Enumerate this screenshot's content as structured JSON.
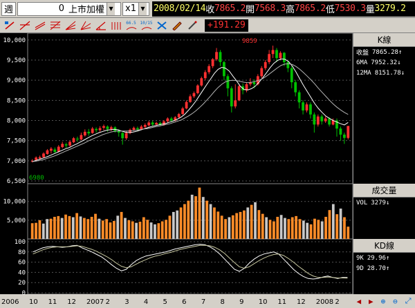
{
  "quote_bar": {
    "period": "週",
    "stock_code": "0",
    "stock_name": "上市加權",
    "multiplier": "x1",
    "date": "2008/02/14",
    "close_label": "收",
    "close": "7865.2",
    "open_label": "開",
    "open": "7568.3",
    "high_label": "高",
    "high": "7865.2",
    "low_label": "低",
    "low": "7530.3",
    "volume_label": "量",
    "volume": "3279.2"
  },
  "toolbar": {
    "change": "+191.29",
    "tool_icons": [
      "cursor-draw-icon",
      "trendline-icon",
      "parallel-line-icon",
      "fibonacci-icon",
      "fan-icon",
      "speed-line-icon",
      "angle-icon",
      "cycle-icon",
      "ma-66-icon",
      "ma-10-15-icon",
      "delete-icon",
      "pencil-icon",
      "hand-icon"
    ],
    "ma_short": "66.5",
    "ma_pair": "10/15"
  },
  "kline_panel": {
    "title": "K線",
    "rows": [
      {
        "label": "收盤",
        "value": "7865.28",
        "arrow": "↑"
      },
      {
        "label": "6MA",
        "value": "7952.32",
        "arrow": "↓"
      },
      {
        "label": "12MA",
        "value": "8151.78",
        "arrow": "↓"
      }
    ],
    "low_mark": "6980",
    "high_mark": "9859",
    "colors": {
      "ma6": "#ffffff",
      "ma12": "#c8c8c8",
      "up": "#ff3030",
      "down": "#00c000"
    }
  },
  "volume_panel": {
    "title": "成交量",
    "rows": [
      {
        "label": "VOL",
        "value": "3279",
        "arrow": "↓"
      }
    ]
  },
  "kd_panel": {
    "title": "KD線",
    "rows": [
      {
        "label": "9K",
        "value": "29.96",
        "arrow": "↑"
      },
      {
        "label": "9D",
        "value": "28.70",
        "arrow": "↑"
      }
    ]
  },
  "nav_icons": [
    "scroll-left-icon",
    "scroll-right-icon",
    "zoom-in-icon",
    "zoom-out-icon",
    "restore-icon"
  ],
  "chart_data": [
    {
      "type": "candlestick",
      "title": "K線",
      "yticks": [
        "10,000",
        "9,500",
        "9,000",
        "8,500",
        "8,000",
        "7,500",
        "7,000",
        "6,500"
      ],
      "ylim": [
        6500,
        10100
      ],
      "xticks": [
        "2006",
        "10",
        "11",
        "12",
        "2007",
        "2",
        "3",
        "4",
        "5",
        "6",
        "7",
        "8",
        "9",
        "10",
        "11",
        "12",
        "2008",
        "2"
      ],
      "candles": [
        [
          6980,
          7000,
          6960,
          7040
        ],
        [
          7020,
          7080,
          7000,
          7110
        ],
        [
          7060,
          7090,
          7030,
          7130
        ],
        [
          7090,
          7180,
          7070,
          7210
        ],
        [
          7170,
          7260,
          7150,
          7290
        ],
        [
          7250,
          7300,
          7180,
          7340
        ],
        [
          7280,
          7220,
          7180,
          7330
        ],
        [
          7230,
          7350,
          7210,
          7390
        ],
        [
          7340,
          7420,
          7310,
          7470
        ],
        [
          7410,
          7380,
          7320,
          7450
        ],
        [
          7380,
          7470,
          7350,
          7500
        ],
        [
          7460,
          7560,
          7440,
          7590
        ],
        [
          7550,
          7530,
          7470,
          7600
        ],
        [
          7530,
          7640,
          7510,
          7700
        ],
        [
          7630,
          7720,
          7600,
          7780
        ],
        [
          7720,
          7680,
          7620,
          7790
        ],
        [
          7690,
          7800,
          7670,
          7840
        ],
        [
          7790,
          7760,
          7700,
          7830
        ],
        [
          7760,
          7810,
          7720,
          7860
        ],
        [
          7820,
          7860,
          7760,
          7900
        ],
        [
          7850,
          7790,
          7720,
          7880
        ],
        [
          7790,
          7830,
          7740,
          7870
        ],
        [
          7830,
          7740,
          7700,
          7860
        ],
        [
          7740,
          7700,
          7600,
          7780
        ],
        [
          7690,
          7560,
          7400,
          7720
        ],
        [
          7560,
          7690,
          7520,
          7740
        ],
        [
          7690,
          7770,
          7660,
          7800
        ],
        [
          7770,
          7820,
          7740,
          7850
        ],
        [
          7810,
          7780,
          7730,
          7850
        ],
        [
          7780,
          7850,
          7760,
          7890
        ],
        [
          7840,
          7890,
          7800,
          7930
        ],
        [
          7880,
          7950,
          7850,
          7990
        ],
        [
          7950,
          7900,
          7860,
          7990
        ],
        [
          7900,
          7940,
          7880,
          7970
        ],
        [
          7940,
          7890,
          7860,
          7970
        ],
        [
          7890,
          7980,
          7870,
          8010
        ],
        [
          7980,
          8050,
          7950,
          8080
        ],
        [
          8050,
          8000,
          7960,
          8090
        ],
        [
          8000,
          8080,
          7980,
          8110
        ],
        [
          8080,
          8160,
          8050,
          8190
        ],
        [
          8160,
          8300,
          8140,
          8340
        ],
        [
          8300,
          8460,
          8280,
          8500
        ],
        [
          8460,
          8600,
          8440,
          8650
        ],
        [
          8600,
          8680,
          8560,
          8720
        ],
        [
          8680,
          8870,
          8650,
          8900
        ],
        [
          8870,
          9050,
          8840,
          9090
        ],
        [
          9050,
          9200,
          9000,
          9250
        ],
        [
          9200,
          9350,
          9150,
          9400
        ],
        [
          9350,
          9520,
          9300,
          9550
        ],
        [
          9520,
          9700,
          9480,
          9800
        ],
        [
          9700,
          9450,
          9350,
          9750
        ],
        [
          9450,
          9100,
          9000,
          9480
        ],
        [
          9100,
          8800,
          8600,
          9150
        ],
        [
          8800,
          8350,
          8200,
          8850
        ],
        [
          8350,
          8500,
          8300,
          8900
        ],
        [
          8500,
          8850,
          8480,
          8900
        ],
        [
          8850,
          8750,
          8650,
          8920
        ],
        [
          8750,
          8900,
          8700,
          8950
        ],
        [
          8900,
          8950,
          8850,
          9050
        ],
        [
          8950,
          8900,
          8800,
          9020
        ],
        [
          8900,
          9100,
          8870,
          9150
        ],
        [
          9100,
          9300,
          9050,
          9350
        ],
        [
          9300,
          9450,
          9250,
          9500
        ],
        [
          9450,
          9650,
          9400,
          9750
        ],
        [
          9650,
          9750,
          9550,
          9859
        ],
        [
          9750,
          9550,
          9450,
          9800
        ],
        [
          9550,
          9680,
          9500,
          9720
        ],
        [
          9680,
          9450,
          9350,
          9700
        ],
        [
          9450,
          9300,
          9200,
          9480
        ],
        [
          9300,
          8950,
          8800,
          9350
        ],
        [
          8950,
          8700,
          8600,
          9000
        ],
        [
          8700,
          8450,
          8300,
          8750
        ],
        [
          8450,
          8250,
          8150,
          8500
        ],
        [
          8250,
          8400,
          8200,
          8450
        ],
        [
          8400,
          8150,
          8050,
          8450
        ],
        [
          8150,
          7900,
          7700,
          8200
        ],
        [
          7900,
          8100,
          7850,
          8150
        ],
        [
          8100,
          7980,
          7900,
          8150
        ],
        [
          7980,
          8050,
          7940,
          8100
        ],
        [
          8050,
          7900,
          7850,
          8080
        ],
        [
          7900,
          8000,
          7880,
          8050
        ],
        [
          8000,
          7800,
          7600,
          8050
        ],
        [
          7800,
          7650,
          7500,
          7850
        ],
        [
          7650,
          7568,
          7420,
          7700
        ],
        [
          7568,
          7865,
          7530,
          7865
        ]
      ],
      "ma6": [
        6980,
        7010,
        7040,
        7070,
        7100,
        7140,
        7180,
        7220,
        7260,
        7300,
        7330,
        7380,
        7420,
        7470,
        7520,
        7570,
        7620,
        7660,
        7700,
        7730,
        7760,
        7770,
        7780,
        7770,
        7740,
        7710,
        7700,
        7710,
        7730,
        7760,
        7790,
        7820,
        7850,
        7870,
        7890,
        7910,
        7930,
        7960,
        7990,
        8030,
        8080,
        8150,
        8250,
        8360,
        8480,
        8620,
        8760,
        8900,
        9030,
        9170,
        9270,
        9320,
        9300,
        9230,
        9100,
        8980,
        8850,
        8770,
        8760,
        8790,
        8850,
        8950,
        9060,
        9180,
        9310,
        9420,
        9490,
        9530,
        9520,
        9460,
        9350,
        9200,
        9030,
        8870,
        8720,
        8570,
        8420,
        8300,
        8200,
        8110,
        8050,
        8000,
        7960,
        7920,
        7890,
        7952
      ],
      "ma12": [
        6980,
        6990,
        7010,
        7030,
        7060,
        7090,
        7120,
        7160,
        7200,
        7240,
        7280,
        7320,
        7360,
        7400,
        7440,
        7490,
        7530,
        7570,
        7610,
        7650,
        7680,
        7710,
        7730,
        7740,
        7740,
        7740,
        7740,
        7750,
        7760,
        7770,
        7790,
        7800,
        7820,
        7840,
        7860,
        7880,
        7900,
        7920,
        7950,
        7980,
        8010,
        8060,
        8110,
        8170,
        8240,
        8320,
        8410,
        8510,
        8610,
        8720,
        8820,
        8900,
        8960,
        8990,
        9000,
        8990,
        8970,
        8950,
        8940,
        8950,
        8970,
        9000,
        9040,
        9100,
        9170,
        9240,
        9310,
        9370,
        9400,
        9410,
        9390,
        9340,
        9270,
        9190,
        9100,
        9010,
        8910,
        8800,
        8700,
        8600,
        8500,
        8410,
        8330,
        8260,
        8200,
        8151
      ]
    },
    {
      "type": "bar",
      "title": "成交量",
      "yticks": [
        "10,000",
        "5,000"
      ],
      "ylim": [
        0,
        14000
      ],
      "values": [
        4200,
        4300,
        5000,
        4100,
        5300,
        5400,
        5900,
        6100,
        5600,
        6500,
        6100,
        5800,
        6900,
        6000,
        5600,
        5300,
        5900,
        6700,
        5400,
        4900,
        5300,
        4400,
        4800,
        6200,
        7200,
        5600,
        5000,
        4700,
        4300,
        4600,
        5800,
        5100,
        4400,
        3900,
        4200,
        4700,
        5100,
        6200,
        7200,
        7600,
        8400,
        9300,
        10200,
        11800,
        11400,
        13700,
        11200,
        10200,
        9300,
        8400,
        7300,
        6200,
        5300,
        5800,
        6300,
        6900,
        7200,
        7600,
        8400,
        9100,
        9800,
        7700,
        6700,
        5800,
        5100,
        4700,
        5900,
        6400,
        5600,
        5300,
        5800,
        6100,
        5300,
        4900,
        4300,
        3900,
        5400,
        5100,
        4700,
        5900,
        7700,
        9300,
        6600,
        8100,
        5800,
        3279
      ],
      "colors": {
        "up": "#ff8c28",
        "down": "#c8c8c8"
      }
    },
    {
      "type": "line",
      "title": "KD線",
      "yticks": [
        "100",
        "80",
        "60",
        "40",
        "20",
        "0"
      ],
      "ylim": [
        0,
        100
      ],
      "series": [
        {
          "name": "9K",
          "values": [
            80,
            84,
            88,
            90,
            91,
            90,
            89,
            90,
            92,
            93,
            88,
            84,
            80,
            75,
            70,
            63,
            55,
            48,
            43,
            46,
            55,
            63,
            68,
            72,
            74,
            76,
            78,
            80,
            83,
            86,
            88,
            90,
            92,
            94,
            95,
            94,
            90,
            84,
            76,
            66,
            56,
            46,
            42,
            48,
            58,
            66,
            72,
            76,
            78,
            80,
            76,
            66,
            56,
            46,
            38,
            32,
            28,
            27,
            28,
            31,
            33,
            30,
            28,
            30,
            29.96
          ]
        },
        {
          "name": "9D",
          "values": [
            76,
            80,
            84,
            87,
            89,
            90,
            90,
            90,
            91,
            92,
            91,
            88,
            85,
            81,
            76,
            71,
            65,
            58,
            52,
            49,
            51,
            56,
            61,
            65,
            69,
            72,
            74,
            77,
            79,
            82,
            85,
            87,
            89,
            91,
            93,
            93,
            92,
            89,
            84,
            77,
            68,
            59,
            51,
            48,
            51,
            57,
            63,
            68,
            72,
            75,
            76,
            73,
            67,
            60,
            52,
            45,
            38,
            33,
            30,
            30,
            31,
            30,
            29,
            29,
            28.7
          ]
        }
      ]
    }
  ]
}
